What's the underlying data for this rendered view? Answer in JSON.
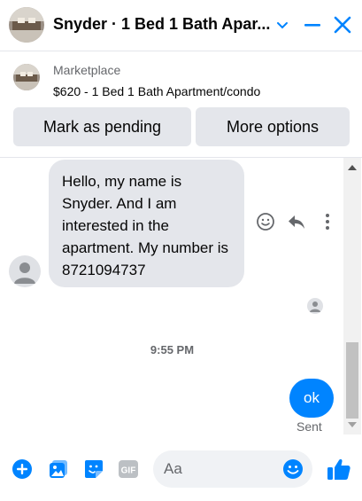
{
  "header": {
    "title": "Snyder · 1 Bed 1 Bath Apar...",
    "icons": [
      "chevron-down-icon",
      "minimize-icon",
      "close-icon"
    ]
  },
  "marketplace": {
    "label": "Marketplace",
    "listing": "$620 - 1 Bed 1 Bath Apartment/condo",
    "buttons": {
      "pending": "Mark as pending",
      "more": "More options"
    }
  },
  "conversation": {
    "incoming_message": "Hello, my name is Snyder. And I am interested in the apartment. My number is 8721094737",
    "timestamp": "9:55 PM",
    "outgoing_message": "ok",
    "status": "Sent"
  },
  "composer": {
    "placeholder": "Aa",
    "gif_label": "GIF"
  },
  "colors": {
    "accent": "#0084ff",
    "bubble_gray": "#e4e6eb",
    "secondary_text": "#65676b"
  }
}
